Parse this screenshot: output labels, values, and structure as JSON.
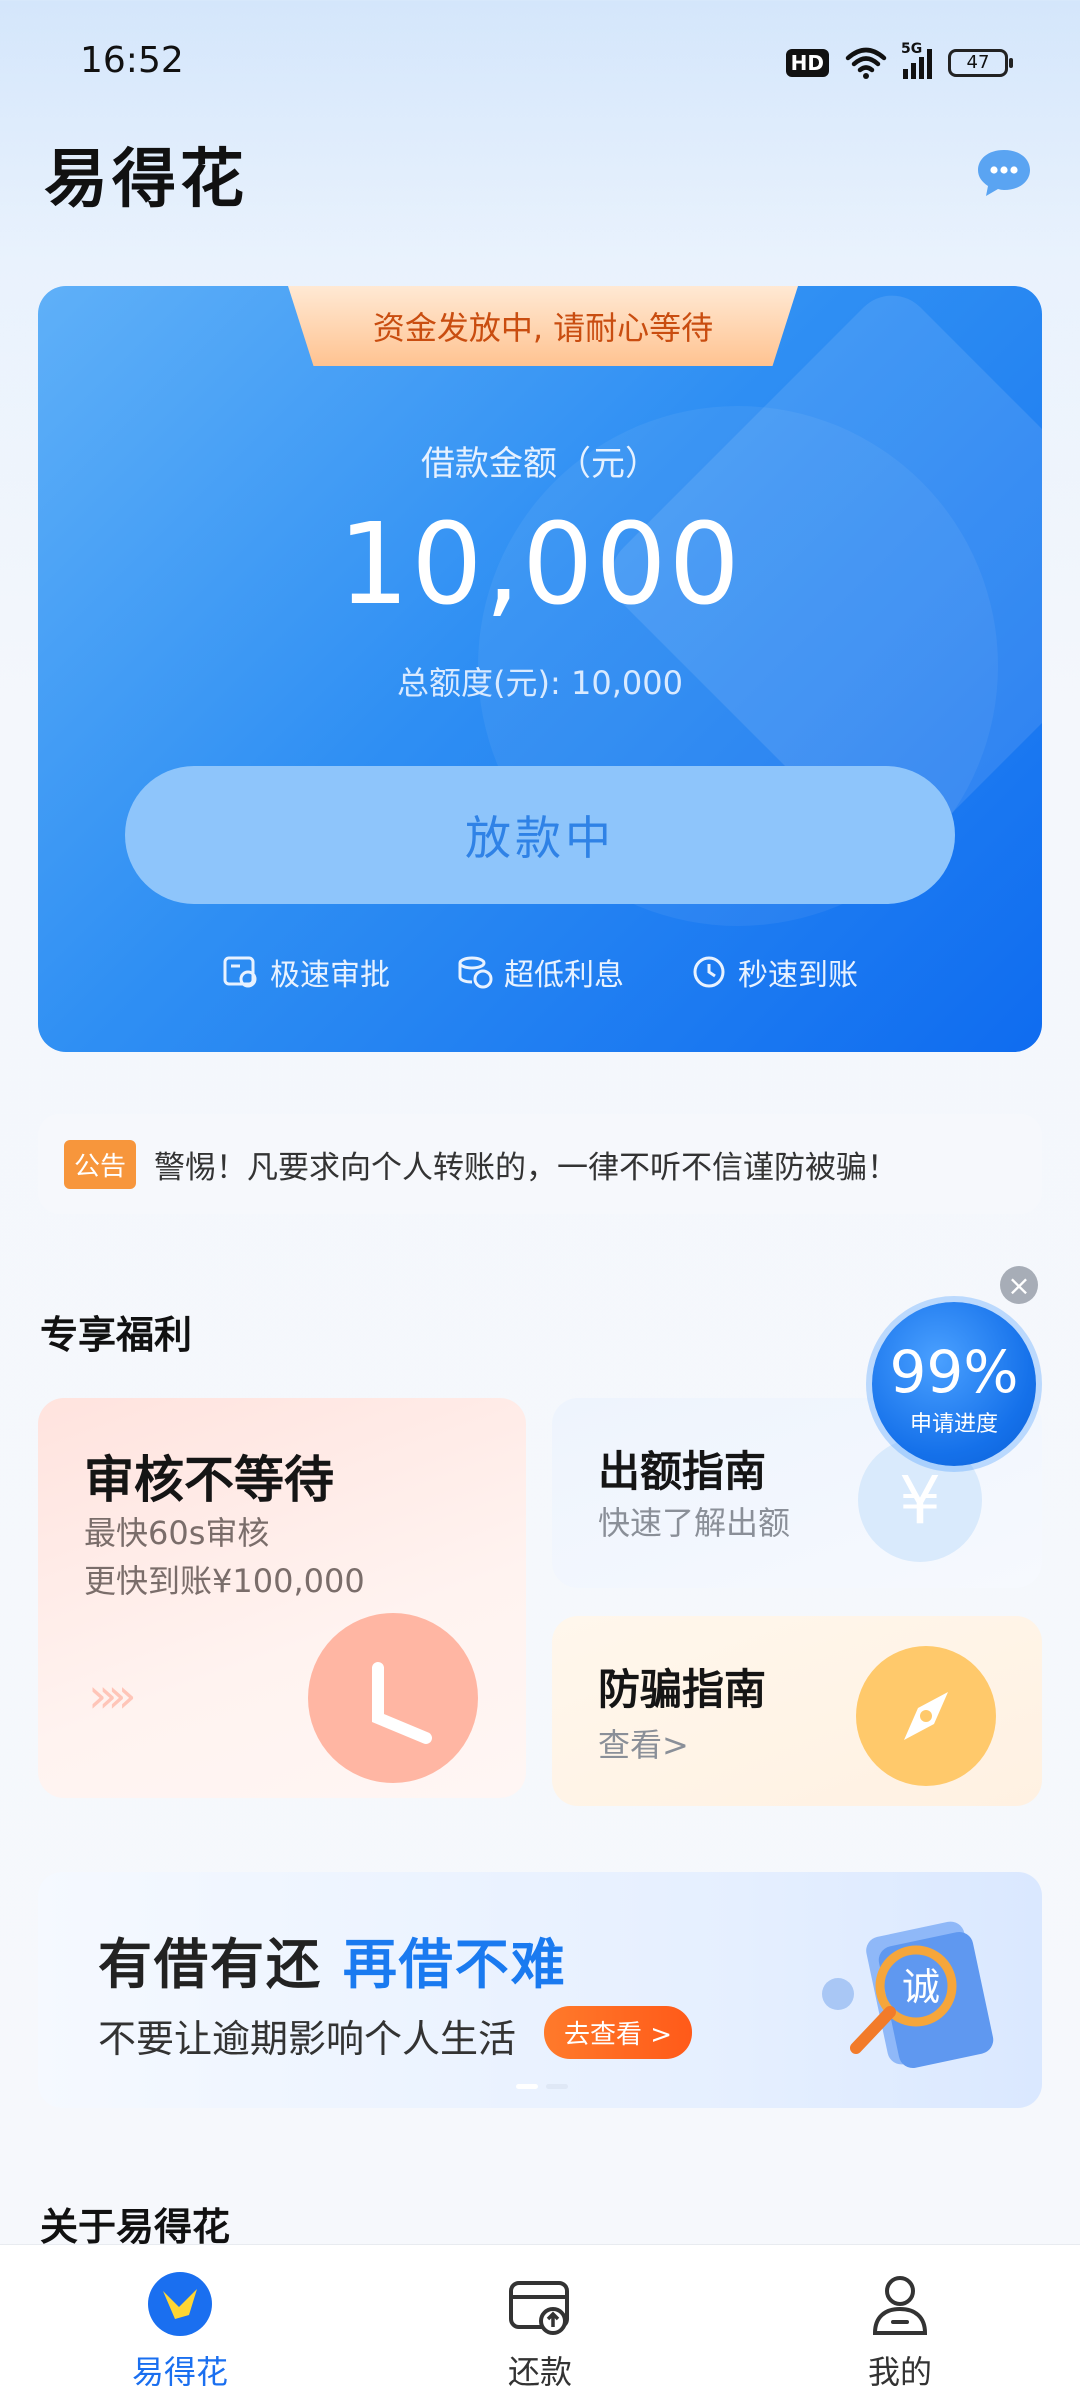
{
  "status_bar": {
    "time": "16:52",
    "network": "5G",
    "hd": "HD",
    "battery": "47"
  },
  "header": {
    "title": "易得花"
  },
  "hero": {
    "tab_notice": "资金发放中, 请耐心等待",
    "amount_label": "借款金额（元）",
    "amount_value": "10,000",
    "total_limit": "总额度(元): 10,000",
    "status_button": "放款中",
    "features": [
      "极速审批",
      "超低利息",
      "秒速到账"
    ]
  },
  "notice": {
    "tag": "公告",
    "text": "警惕！凡要求向个人转账的，一律不听不信谨防被骗！"
  },
  "welfare": {
    "title": "专享福利",
    "card_main": {
      "title": "审核不等待",
      "line1": "最快60s审核",
      "line2": "更快到账¥100,000"
    },
    "card_guide": {
      "title": "出额指南",
      "subtitle": "快速了解出额"
    },
    "card_fraud": {
      "title": "防骗指南",
      "subtitle": "查看>"
    }
  },
  "progress": {
    "percent": "99%",
    "label": "申请进度",
    "close": "×"
  },
  "banner": {
    "title_dark": "有借有还",
    "title_blue": "再借不难",
    "subtitle": "不要让逾期影响个人生活",
    "cta": "去查看 >",
    "illustration_text": "诚"
  },
  "about": {
    "title": "关于易得花"
  },
  "bottom_nav": [
    {
      "label": "易得花",
      "active": true
    },
    {
      "label": "还款",
      "active": false
    },
    {
      "label": "我的",
      "active": false
    }
  ],
  "colors": {
    "primary": "#1a6ff0",
    "accent_orange": "#f7963c",
    "hero_start": "#5fb0f8",
    "hero_end": "#0f6cf0"
  }
}
